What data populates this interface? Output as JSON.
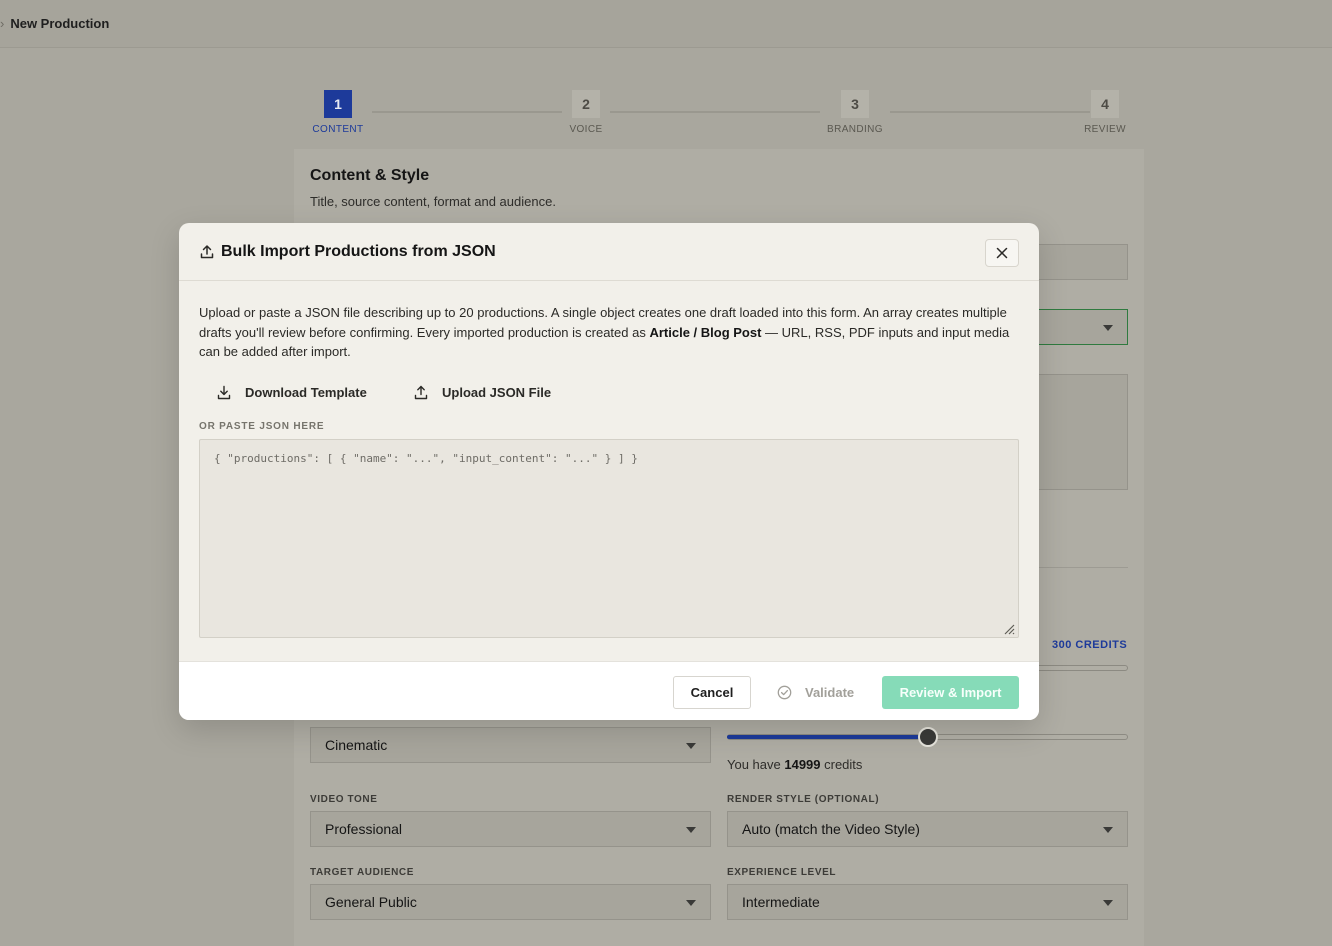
{
  "breadcrumb": {
    "separator": "›",
    "current": "New Production"
  },
  "stepper": {
    "steps": [
      {
        "num": "1",
        "label": "CONTENT",
        "active": true
      },
      {
        "num": "2",
        "label": "VOICE",
        "active": false
      },
      {
        "num": "3",
        "label": "BRANDING",
        "active": false
      },
      {
        "num": "4",
        "label": "REVIEW",
        "active": false
      }
    ]
  },
  "card": {
    "title": "Content & Style",
    "subtitle": "Title, source content, format and audience."
  },
  "background_form": {
    "credits_badge": "300 CREDITS",
    "style_value": "Cinematic",
    "duration_slider_fraction": 0.5,
    "credits_prefix": "You have ",
    "credits_amount": "14999",
    "credits_suffix": " credits",
    "video_tone": {
      "label": "VIDEO TONE",
      "value": "Professional"
    },
    "render_style": {
      "label": "RENDER STYLE (OPTIONAL)",
      "value": "Auto (match the Video Style)"
    },
    "target_audience": {
      "label": "TARGET AUDIENCE",
      "value": "General Public"
    },
    "experience_level": {
      "label": "EXPERIENCE LEVEL",
      "value": "Intermediate"
    }
  },
  "modal": {
    "title": "Bulk Import Productions from JSON",
    "desc_part1": "Upload or paste a JSON file describing up to 20 productions. A single object creates one draft loaded into this form. An array creates multiple drafts you'll review before confirming. Every imported production is created as ",
    "desc_bold": "Article / Blog Post",
    "desc_part2": " — URL, RSS, PDF inputs and input media can be added after import.",
    "download_label": "Download Template",
    "upload_label": "Upload JSON File",
    "paste_label": "OR PASTE JSON HERE",
    "json_placeholder": "{ \"productions\": [ { \"name\": \"...\", \"input_content\": \"...\" } ] }",
    "json_value": "",
    "cancel_label": "Cancel",
    "validate_label": "Validate",
    "review_label": "Review & Import"
  },
  "colors": {
    "accent_blue": "#1d3a9a",
    "review_button": "#86dbb8",
    "overlay": "#a9a79e"
  },
  "icons": {
    "header": "upload-icon",
    "close": "close-icon",
    "download": "download-icon",
    "upload": "upload-icon",
    "validate": "check-circle-icon"
  }
}
